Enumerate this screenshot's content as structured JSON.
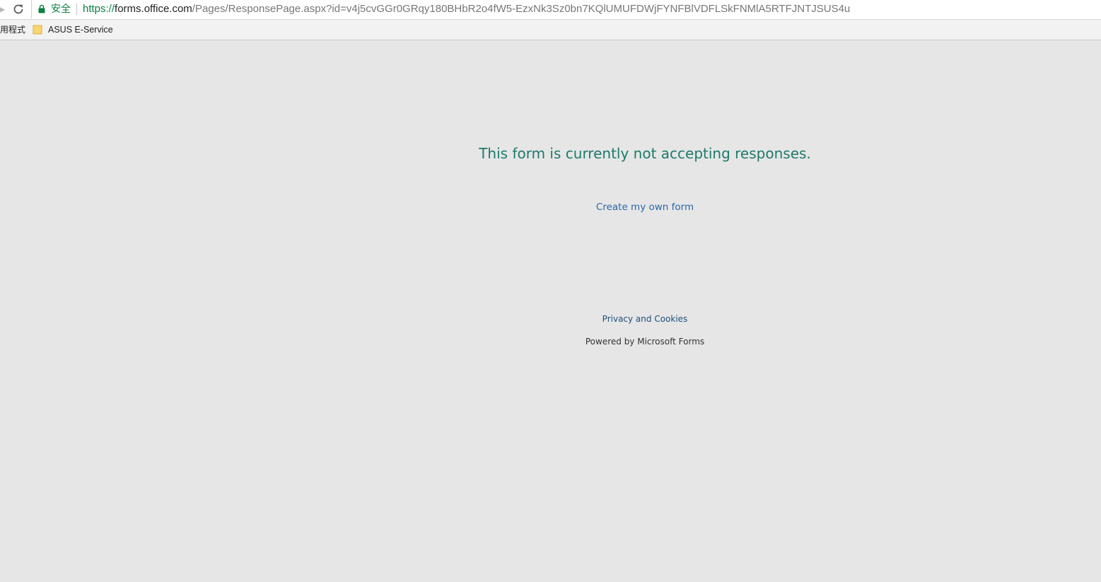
{
  "browser": {
    "secure_label": "安全",
    "url_scheme": "https://",
    "url_host": "forms.office.com",
    "url_path": "/Pages/ResponsePage.aspx?id=v4j5cvGGr0GRqy180BHbR2o4fW5-EzxNk3Sz0bn7KQlUMUFDWjFYNFBlVDFLSkFNMlA5RTFJNTJSUS4u",
    "icons": {
      "forward": "forward-arrow-icon",
      "reload": "reload-icon",
      "lock": "lock-icon"
    }
  },
  "bookmarks_bar": {
    "apps_label": "用程式",
    "items": [
      {
        "label": "ASUS E-Service",
        "icon": "folder-icon"
      }
    ]
  },
  "page": {
    "message": "This form is currently not accepting responses.",
    "create_link": "Create my own form",
    "privacy_link": "Privacy and Cookies",
    "powered_by": "Powered by Microsoft Forms"
  },
  "colors": {
    "background": "#e6e6e6",
    "message": "#1e7a6a",
    "link": "#2b66a8",
    "secure": "#0b8043"
  }
}
